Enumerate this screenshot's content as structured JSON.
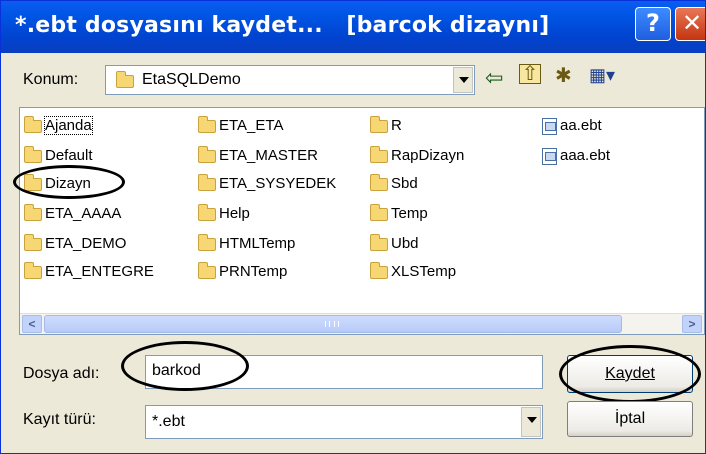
{
  "window": {
    "title": "*.ebt dosyasını kaydet...   [barcok dizaynı]",
    "help_glyph": "?",
    "close_glyph": "✕"
  },
  "location": {
    "label": "Konum:",
    "value": "EtaSQLDemo"
  },
  "toolbar": {
    "back_glyph": "⇦",
    "up_glyph": "⇧",
    "new_folder_glyph": "✱",
    "view_glyph": "▦▾"
  },
  "files": {
    "col1": [
      "Ajanda",
      "Default",
      "Dizayn",
      "ETA_AAAA",
      "ETA_DEMO",
      "ETA_ENTEGRE"
    ],
    "col2": [
      "ETA_ETA",
      "ETA_MASTER",
      "ETA_SYSYEDEK",
      "Help",
      "HTMLTemp",
      "PRNTemp"
    ],
    "col3": [
      "R",
      "RapDizayn",
      "Sbd",
      "Temp",
      "Ubd",
      "XLSTemp"
    ],
    "col4": [
      "aa.ebt",
      "aaa.ebt"
    ]
  },
  "scrollbar": {
    "left_glyph": "<",
    "right_glyph": ">"
  },
  "filename": {
    "label": "Dosya adı:",
    "value": "barkod"
  },
  "filetype": {
    "label": "Kayıt türü:",
    "value": "*.ebt"
  },
  "buttons": {
    "save": "Kaydet",
    "cancel": "İptal"
  },
  "colors": {
    "titlebar": "#0054e3",
    "dialog_bg": "#ece9d8",
    "folder": "#f7d774"
  }
}
